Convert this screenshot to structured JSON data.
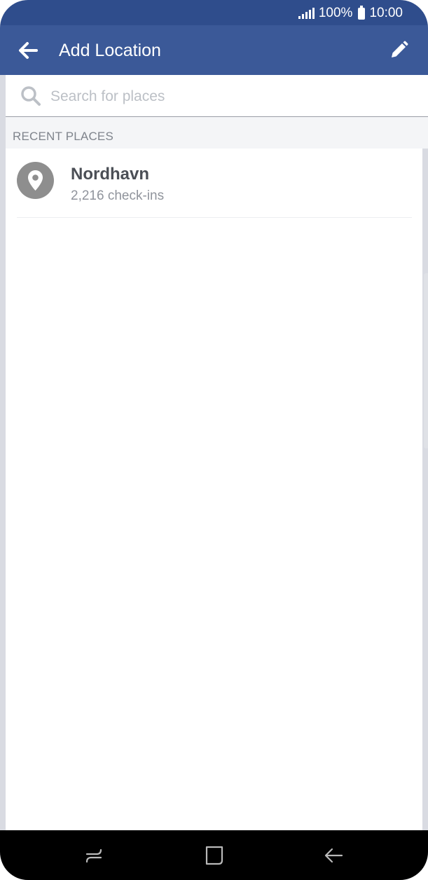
{
  "status_bar": {
    "battery": "100%",
    "time": "10:00"
  },
  "app_bar": {
    "title": "Add Location"
  },
  "search": {
    "placeholder": "Search for places",
    "value": ""
  },
  "recent": {
    "header": "RECENT PLACES",
    "items": [
      {
        "name": "Nordhavn",
        "subtitle": "2,216 check-ins",
        "icon": "location-pin-icon"
      }
    ]
  },
  "colors": {
    "status_bar": "#2f4d8c",
    "app_bar": "#3b5998",
    "section_bg": "#f4f5f7",
    "place_icon_bg": "#8e8e8e",
    "nav_bar": "#000000"
  }
}
